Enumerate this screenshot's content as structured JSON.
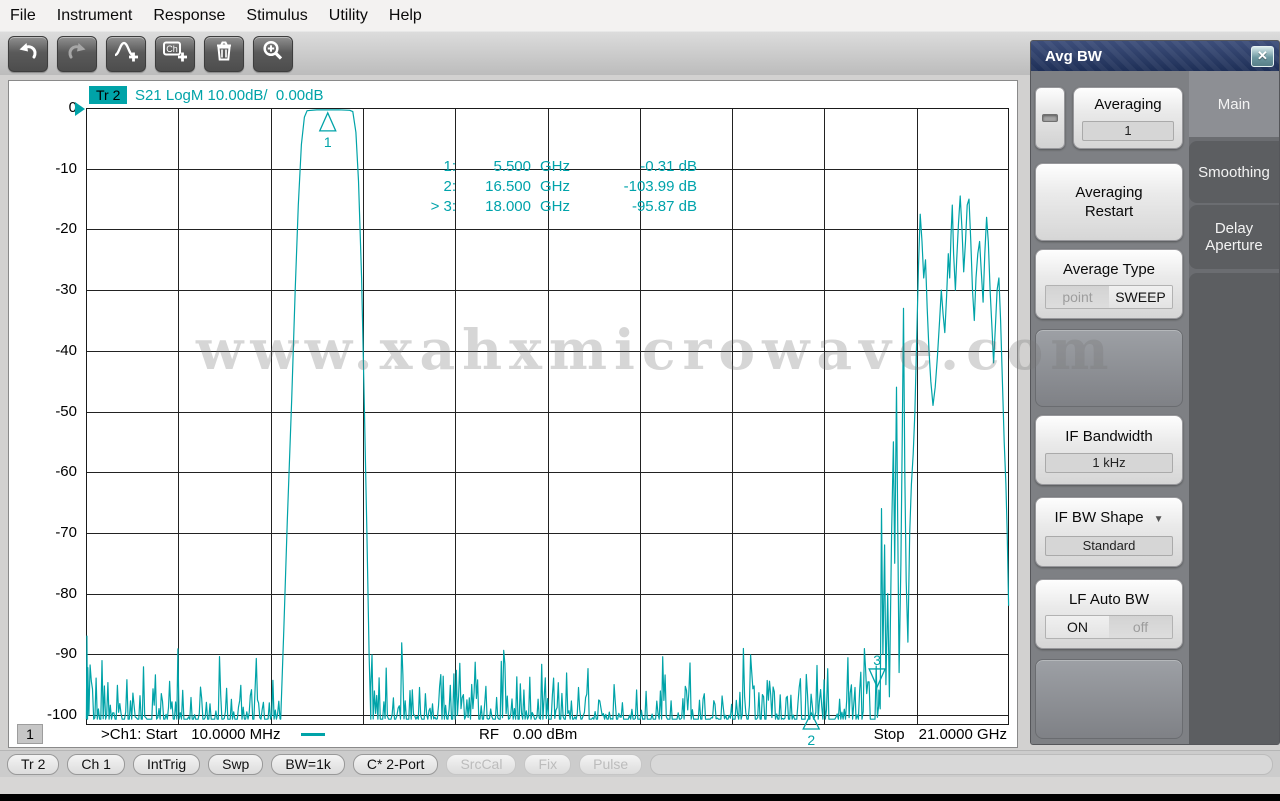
{
  "menu": {
    "items": [
      "File",
      "Instrument",
      "Response",
      "Stimulus",
      "Utility",
      "Help"
    ]
  },
  "toolbar": {
    "buttons": [
      {
        "icon": "undo-icon",
        "enabled": true
      },
      {
        "icon": "redo-icon",
        "enabled": false
      },
      {
        "icon": "add-trace-icon",
        "enabled": true
      },
      {
        "icon": "add-channel-icon",
        "enabled": true
      },
      {
        "icon": "delete-trace-icon",
        "enabled": true
      },
      {
        "icon": "zoom-in-icon",
        "enabled": true
      }
    ]
  },
  "chart": {
    "trace_badge": "Tr 2",
    "trace_label": "S21 LogM 10.00dB/  0.00dB",
    "trace_color": "#00a3a8",
    "y_ticks": [
      "0",
      "-10",
      "-20",
      "-30",
      "-40",
      "-50",
      "-60",
      "-70",
      "-80",
      "-90",
      "-100"
    ],
    "axis": {
      "f_start_ghz": 0.01,
      "f_stop_ghz": 21,
      "db_top": 0,
      "db_bottom": -100,
      "db_per_div": 10,
      "x_divs": 10
    },
    "readout": [
      {
        "num": "1:",
        "freq": "5.500",
        "unit": "GHz",
        "val": "-0.31 dB"
      },
      {
        "num": "2:",
        "freq": "16.500",
        "unit": "GHz",
        "val": "-103.99 dB"
      },
      {
        "num": "> 3:",
        "freq": "18.000",
        "unit": "GHz",
        "val": "-95.87 dB"
      }
    ],
    "markers": [
      {
        "n": "1",
        "f": 5.5,
        "db": -0.31,
        "mode": "above"
      },
      {
        "n": "2",
        "f": 16.5,
        "db": -103.99,
        "mode": "clamped"
      },
      {
        "n": "3",
        "f": 18.0,
        "db": -95.87,
        "mode": "below"
      }
    ],
    "footer": {
      "channel": "1",
      "start_label": ">Ch1: Start",
      "start_value": "10.0000 MHz",
      "rf_label": "RF",
      "rf_value": "0.00 dBm",
      "stop_label": "Stop",
      "stop_value": "21.0000 GHz"
    },
    "watermark": "www.xahxmicrowave.com",
    "trace_segments": [
      {
        "type": "line",
        "pts": [
          [
            0.01,
            -100.7
          ],
          [
            0.02,
            -87
          ],
          [
            0.035,
            -100.7
          ]
        ]
      },
      {
        "type": "noise",
        "f0": 0.04,
        "f1": 4.43,
        "base": -100.7,
        "peak": 13
      },
      {
        "type": "line",
        "pts": [
          [
            4.43,
            -100.7
          ],
          [
            4.5,
            -86
          ],
          [
            4.58,
            -68
          ],
          [
            4.68,
            -48
          ],
          [
            4.76,
            -30
          ],
          [
            4.83,
            -16
          ],
          [
            4.9,
            -6
          ],
          [
            4.97,
            -1.5
          ],
          [
            5.03,
            -0.45
          ]
        ]
      },
      {
        "type": "line",
        "pts": [
          [
            5.25,
            -0.32
          ],
          [
            5.5,
            -0.31
          ],
          [
            5.75,
            -0.3
          ],
          [
            6.0,
            -0.38
          ],
          [
            6.07,
            -0.6
          ]
        ]
      },
      {
        "type": "line",
        "pts": [
          [
            6.14,
            -4
          ],
          [
            6.2,
            -12
          ],
          [
            6.27,
            -28
          ],
          [
            6.33,
            -48
          ],
          [
            6.39,
            -70
          ],
          [
            6.44,
            -90
          ],
          [
            6.48,
            -100.7
          ]
        ]
      },
      {
        "type": "noise",
        "f0": 6.48,
        "f1": 17.52,
        "base": -100.7,
        "peak": 13
      },
      {
        "type": "noise",
        "f0": 17.52,
        "f1": 18.04,
        "base": -100.7,
        "peak": 20
      },
      {
        "type": "line",
        "pts": [
          [
            18.04,
            -95.9
          ],
          [
            18.07,
            -99
          ],
          [
            18.1,
            -66
          ],
          [
            18.13,
            -90
          ],
          [
            18.17,
            -72
          ],
          [
            18.2,
            -95
          ],
          [
            18.24,
            -80
          ],
          [
            18.28,
            -97
          ],
          [
            18.33,
            -70
          ],
          [
            18.37,
            -55
          ],
          [
            18.4,
            -75
          ],
          [
            18.44,
            -46
          ],
          [
            18.47,
            -70
          ],
          [
            18.5,
            -93
          ],
          [
            18.54,
            -75
          ],
          [
            18.57,
            -55
          ],
          [
            18.6,
            -33
          ],
          [
            18.63,
            -60
          ],
          [
            18.66,
            -78
          ],
          [
            18.7,
            -88
          ],
          [
            18.74,
            -70
          ],
          [
            18.78,
            -62
          ],
          [
            18.82,
            -57
          ],
          [
            18.86,
            -50
          ],
          [
            18.9,
            -38
          ],
          [
            18.94,
            -26
          ],
          [
            18.98,
            -17.5
          ],
          [
            19.02,
            -22
          ],
          [
            19.06,
            -28
          ],
          [
            19.1,
            -25
          ],
          [
            19.14,
            -33
          ],
          [
            19.18,
            -40
          ],
          [
            19.22,
            -45
          ],
          [
            19.27,
            -49
          ],
          [
            19.32,
            -46
          ],
          [
            19.37,
            -41
          ],
          [
            19.42,
            -35
          ],
          [
            19.46,
            -30
          ],
          [
            19.5,
            -34
          ],
          [
            19.54,
            -37
          ],
          [
            19.58,
            -31
          ],
          [
            19.62,
            -24
          ],
          [
            19.65,
            -28
          ],
          [
            19.68,
            -21
          ],
          [
            19.71,
            -16
          ],
          [
            19.74,
            -24
          ],
          [
            19.78,
            -30
          ],
          [
            19.81,
            -25
          ],
          [
            19.85,
            -19
          ],
          [
            19.89,
            -14.5
          ],
          [
            19.93,
            -20
          ],
          [
            19.97,
            -27
          ],
          [
            20.01,
            -22
          ],
          [
            20.05,
            -16
          ],
          [
            20.09,
            -15
          ],
          [
            20.13,
            -22
          ],
          [
            20.17,
            -30
          ],
          [
            20.21,
            -35
          ],
          [
            20.25,
            -28
          ],
          [
            20.29,
            -24
          ],
          [
            20.33,
            -22
          ],
          [
            20.37,
            -27
          ],
          [
            20.41,
            -32
          ],
          [
            20.45,
            -24
          ],
          [
            20.49,
            -18
          ],
          [
            20.53,
            -22
          ],
          [
            20.57,
            -30
          ],
          [
            20.61,
            -36
          ],
          [
            20.65,
            -42
          ],
          [
            20.69,
            -36
          ],
          [
            20.73,
            -30
          ],
          [
            20.77,
            -28
          ],
          [
            20.81,
            -35
          ],
          [
            20.85,
            -45
          ],
          [
            20.89,
            -55
          ],
          [
            20.93,
            -62
          ],
          [
            20.96,
            -70
          ],
          [
            20.99,
            -82
          ]
        ]
      }
    ]
  },
  "panel": {
    "title": "Avg BW",
    "icons": {
      "close": "✕",
      "dropdown": "▼"
    },
    "tabs": [
      {
        "label": "Main",
        "active": true
      },
      {
        "label": "Smoothing",
        "active": false
      },
      {
        "label": "Delay Aperture",
        "active": false
      }
    ],
    "averaging": {
      "label": "Averaging",
      "value": "1"
    },
    "averaging_restart": {
      "label": "Averaging Restart"
    },
    "average_type": {
      "label": "Average Type",
      "options": [
        "point",
        "SWEEP"
      ],
      "selected_index": 1
    },
    "if_bandwidth": {
      "label": "IF Bandwidth",
      "value": "1 kHz"
    },
    "if_bw_shape": {
      "label": "IF BW Shape",
      "value": "Standard"
    },
    "lf_auto_bw": {
      "label": "LF Auto BW",
      "options": [
        "ON",
        "off"
      ],
      "selected_index": 0
    }
  },
  "statusbar": {
    "buttons": [
      {
        "label": "Tr 2",
        "enabled": true
      },
      {
        "label": "Ch 1",
        "enabled": true
      },
      {
        "label": "IntTrig",
        "enabled": true
      },
      {
        "label": "Swp",
        "enabled": true
      },
      {
        "label": "BW=1k",
        "enabled": true
      },
      {
        "label": "C* 2-Port",
        "enabled": true
      },
      {
        "label": "SrcCal",
        "enabled": false
      },
      {
        "label": "Fix",
        "enabled": false
      },
      {
        "label": "Pulse",
        "enabled": false
      }
    ]
  }
}
